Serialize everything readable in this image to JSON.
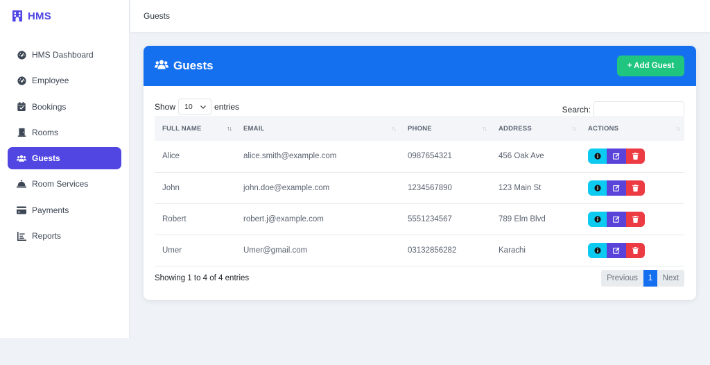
{
  "app": {
    "brand": "HMS"
  },
  "sidebar": {
    "items": [
      {
        "label": "HMS Dashboard",
        "icon": "gauge-icon"
      },
      {
        "label": "Employee",
        "icon": "gauge-icon"
      },
      {
        "label": "Bookings",
        "icon": "calendar-check-icon"
      },
      {
        "label": "Rooms",
        "icon": "door-icon"
      },
      {
        "label": "Guests",
        "icon": "users-icon",
        "active": true
      },
      {
        "label": "Room Services",
        "icon": "concierge-bell-icon"
      },
      {
        "label": "Payments",
        "icon": "credit-card-icon"
      },
      {
        "label": "Reports",
        "icon": "chart-icon"
      }
    ]
  },
  "topbar": {
    "title": "Guests"
  },
  "card": {
    "title": "Guests",
    "add_label": "+ Add Guest",
    "show_label": "Show",
    "entries_value": "10",
    "entries_label": "entries",
    "search_label": "Search:",
    "search_value": ""
  },
  "table": {
    "columns": [
      "FULL NAME",
      "EMAIL",
      "PHONE",
      "ADDRESS",
      "ACTIONS"
    ],
    "rows": [
      {
        "name": "Alice",
        "email": "alice.smith@example.com",
        "phone": "0987654321",
        "address": "456 Oak Ave"
      },
      {
        "name": "John",
        "email": "john.doe@example.com",
        "phone": "1234567890",
        "address": "123 Main St"
      },
      {
        "name": "Robert",
        "email": "robert.j@example.com",
        "phone": "5551234567",
        "address": "789 Elm Blvd"
      },
      {
        "name": "Umer",
        "email": "Umer@gmail.com",
        "phone": "03132856282",
        "address": "Karachi"
      }
    ]
  },
  "footer": {
    "info": "Showing 1 to 4 of 4 entries",
    "prev": "Previous",
    "page": "1",
    "next": "Next"
  },
  "colors": {
    "primary": "#1570ef",
    "accent": "#5146e1",
    "success": "#20c580",
    "info": "#0dcaf0",
    "danger": "#ed3b44"
  }
}
